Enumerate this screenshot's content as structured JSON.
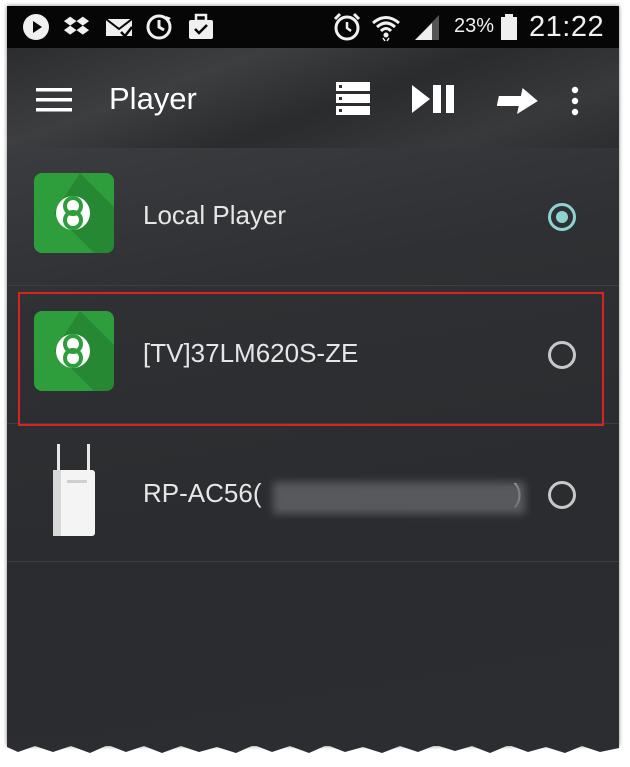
{
  "status_bar": {
    "battery_percent": "23%",
    "time": "21:22",
    "icons": [
      "play-icon",
      "dropbox-icon",
      "mail-icon",
      "sync-icon",
      "briefcase-icon",
      "alarm-icon",
      "wifi-icon",
      "signal-icon",
      "battery-icon"
    ]
  },
  "action_bar": {
    "title": "Player",
    "icons": [
      "menu-icon",
      "playlist-icon",
      "play-pause-icon",
      "forward-icon",
      "overflow-icon"
    ]
  },
  "players": [
    {
      "label": "Local Player",
      "selected": true,
      "icon": "app-logo-icon"
    },
    {
      "label": "[TV]37LM620S-ZE",
      "selected": false,
      "icon": "app-logo-icon",
      "highlighted": true
    },
    {
      "label_prefix": "RP-AC56(",
      "label_suffix": ")",
      "selected": false,
      "icon": "router-icon"
    }
  ],
  "colors": {
    "accent": "#8fd3d0",
    "highlight_border": "#d8231f",
    "logo_green": "#2e9e3c"
  }
}
